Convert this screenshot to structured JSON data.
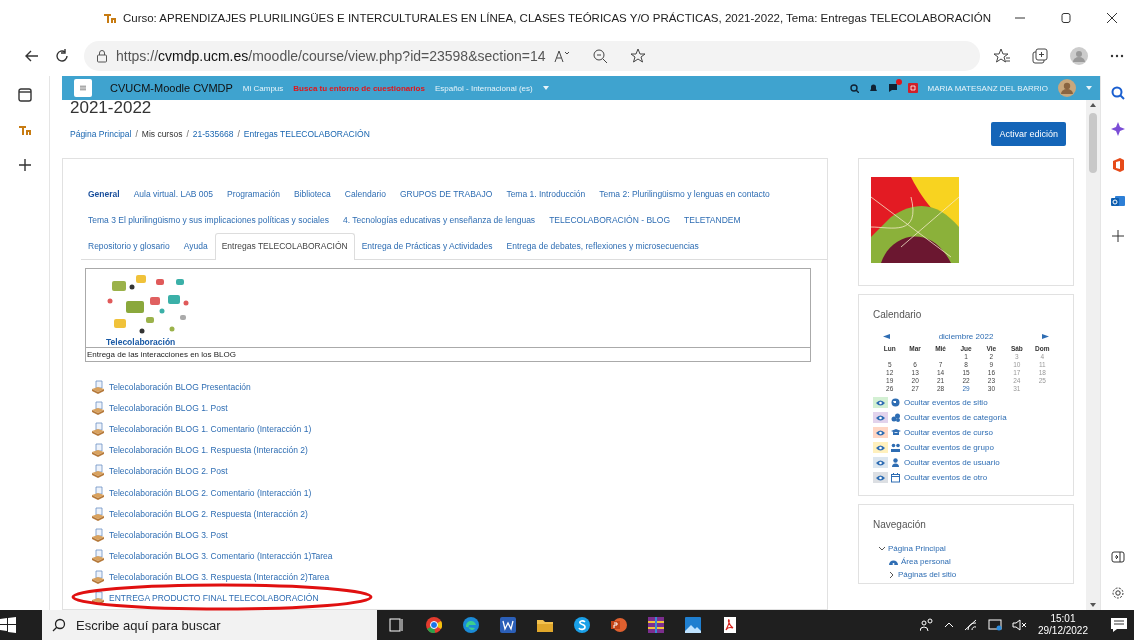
{
  "window": {
    "title": "Curso: APRENDIZAJES PLURILINGÜES E INTERCULTURALES EN LÍNEA, CLASES TEÓRICAS Y/O PRÁCTICAS, 2021-2022, Tema: Entregas TELECOLABORACIÓN"
  },
  "address_bar": {
    "url": "https://**cvmdp.ucm.es**/moodle/course/view.php?id=23598&section=14"
  },
  "navbar": {
    "brand": "CVUCM-Moodle CVMDP",
    "links": [
      {
        "label": "Mi Campus",
        "kind": "plain"
      },
      {
        "label": "Busca tu entorno de cuestionarios",
        "kind": "alert"
      }
    ],
    "language": "Español - Internacional (es)",
    "user": "MARIA MATESANZ DEL BARRIO"
  },
  "course": {
    "heading": "2021-2022",
    "separator": "/",
    "breadcrumb": [
      {
        "label": "Página Principal",
        "link": true
      },
      {
        "label": "Mis cursos",
        "link": false
      },
      {
        "label": "21-535668",
        "link": true
      },
      {
        "label": "Entregas TELECOLABORACIÓN",
        "link": true
      }
    ],
    "edit_button": "Activar edición"
  },
  "tabs": [
    {
      "label": "General",
      "selected": false,
      "highlighted": true
    },
    {
      "label": "Aula virtual. LAB 005",
      "selected": false,
      "highlighted": false
    },
    {
      "label": "Programación",
      "selected": false,
      "highlighted": false
    },
    {
      "label": "Biblioteca",
      "selected": false,
      "highlighted": false
    },
    {
      "label": "Calendario",
      "selected": false,
      "highlighted": false
    },
    {
      "label": "GRUPOS DE TRABAJO",
      "selected": false,
      "highlighted": false
    },
    {
      "label": "Tema 1. Introducción",
      "selected": false,
      "highlighted": false
    },
    {
      "label": "Tema 2: Plurilingüismo y lenguas en contacto",
      "selected": false,
      "highlighted": false
    },
    {
      "label": "Tema 3 El plurilingüismo y sus implicaciones políticas y sociales",
      "selected": false,
      "highlighted": false
    },
    {
      "label": "4. Tecnologías educativas y enseñanza de lenguas",
      "selected": false,
      "highlighted": false
    },
    {
      "label": "TELECOLABORACIÓN - BLOG",
      "selected": false,
      "highlighted": false
    },
    {
      "label": "TELETANDEM",
      "selected": false,
      "highlighted": false
    },
    {
      "label": "Repositorio y glosario",
      "selected": false,
      "highlighted": false
    },
    {
      "label": "Ayuda",
      "selected": false,
      "highlighted": false
    },
    {
      "label": "Entregas TELECOLABORACIÓN",
      "selected": true,
      "highlighted": false
    },
    {
      "label": "Entrega de Prácticas y Actividades",
      "selected": false,
      "highlighted": false
    },
    {
      "label": "Entrega de debates, reflexiones y microsecuencias",
      "selected": false,
      "highlighted": false
    }
  ],
  "section": {
    "image_caption": "Telecolaboración",
    "summary": "Entrega de las interacciones en los BLOG"
  },
  "activities": [
    "Telecolaboración BLOG Presentación",
    "Telecolaboración BLOG 1. Post",
    "Telecolaboración BLOG 1. Comentario (Interacción 1)",
    "Telecolaboración BLOG 1. Respuesta (Interacción 2)",
    "Telecolaboración BLOG 2. Post",
    "Telecolaboración BLOG 2. Comentario (Interacción 1)",
    "Telecolaboración BLOG 2. Respuesta (Interacción 2)",
    "Telecolaboración BLOG 3. Post",
    "Telecolaboración BLOG 3. Comentario (Interacción 1)Tarea",
    "Telecolaboración BLOG 3. Respuesta (Interacción 2)Tarea",
    "ENTREGA PRODUCTO FINAL TELECOLABORACIÓN"
  ],
  "calendar": {
    "title": "Calendario",
    "month": "diciembre 2022",
    "weekdays": [
      "Lun",
      "Mar",
      "Mié",
      "Jue",
      "Vie",
      "Sáb",
      "Dom"
    ],
    "weeks": [
      [
        {
          "d": "1",
          "today": false
        },
        {
          "d": "2",
          "today": false
        },
        {
          "d": "3",
          "today": false
        },
        {
          "d": "4",
          "today": false
        }
      ],
      [
        {
          "d": "5",
          "today": false
        },
        {
          "d": "6",
          "today": false
        },
        {
          "d": "7",
          "today": false
        },
        {
          "d": "8",
          "today": false
        },
        {
          "d": "9",
          "today": false
        },
        {
          "d": "10",
          "today": false
        },
        {
          "d": "11",
          "today": false
        }
      ],
      [
        {
          "d": "12",
          "today": false
        },
        {
          "d": "13",
          "today": false
        },
        {
          "d": "14",
          "today": false
        },
        {
          "d": "15",
          "today": false
        },
        {
          "d": "16",
          "today": false
        },
        {
          "d": "17",
          "today": false
        },
        {
          "d": "18",
          "today": false
        }
      ],
      [
        {
          "d": "19",
          "today": false
        },
        {
          "d": "20",
          "today": false
        },
        {
          "d": "21",
          "today": false
        },
        {
          "d": "22",
          "today": false
        },
        {
          "d": "23",
          "today": false
        },
        {
          "d": "24",
          "today": false
        },
        {
          "d": "25",
          "today": false
        }
      ],
      [
        {
          "d": "26",
          "today": false
        },
        {
          "d": "27",
          "today": false
        },
        {
          "d": "28",
          "today": false
        },
        {
          "d": "29",
          "today": true
        },
        {
          "d": "30",
          "today": false
        },
        {
          "d": "31",
          "today": false
        }
      ]
    ],
    "event_filters": [
      {
        "label": "Ocultar eventos de sitio",
        "color": "#d3f0d3",
        "kind": "site"
      },
      {
        "label": "Ocultar eventos de categoría",
        "color": "#e2d3ec",
        "kind": "category"
      },
      {
        "label": "Ocultar eventos de curso",
        "color": "#ffd6c4",
        "kind": "course"
      },
      {
        "label": "Ocultar eventos de grupo",
        "color": "#fff0bd",
        "kind": "group"
      },
      {
        "label": "Ocultar eventos de usuario",
        "color": "#dce6ef",
        "kind": "user"
      },
      {
        "label": "Ocultar eventos de otro",
        "color": "#dcdfe3",
        "kind": "other"
      }
    ]
  },
  "navigation": {
    "title": "Navegación",
    "items": [
      {
        "label": "Página Principal",
        "kind": "branch",
        "expanded": true,
        "children": [
          {
            "label": "Área personal",
            "kind": "leaf"
          },
          {
            "label": "Páginas del sitio",
            "kind": "branch",
            "expanded": false
          }
        ]
      }
    ]
  },
  "taskbar": {
    "search_placeholder": "Escribe aquí para buscar",
    "time": "15:01",
    "date": "29/12/2022"
  }
}
